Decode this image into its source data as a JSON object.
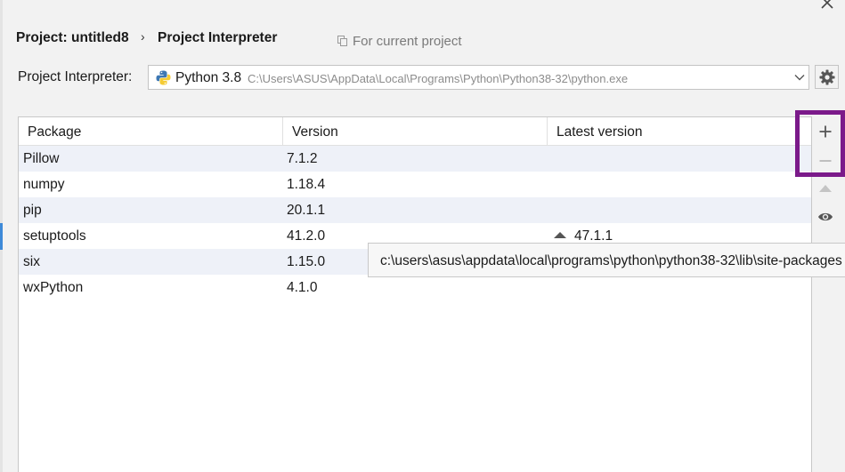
{
  "breadcrumb": {
    "project": "Project: untitled8",
    "separator": "›",
    "page": "Project Interpreter"
  },
  "scope_label": "For current project",
  "interpreter": {
    "label": "Project Interpreter:",
    "name": "Python 3.8",
    "path": "C:\\Users\\ASUS\\AppData\\Local\\Programs\\Python\\Python38-32\\python.exe"
  },
  "table": {
    "columns": [
      "Package",
      "Version",
      "Latest version"
    ],
    "rows": [
      {
        "package": "Pillow",
        "version": "7.1.2",
        "latest": ""
      },
      {
        "package": "numpy",
        "version": "1.18.4",
        "latest": ""
      },
      {
        "package": "pip",
        "version": "20.1.1",
        "latest": ""
      },
      {
        "package": "setuptools",
        "version": "41.2.0",
        "latest": "47.1.1"
      },
      {
        "package": "six",
        "version": "1.15.0",
        "latest": ""
      },
      {
        "package": "wxPython",
        "version": "4.1.0",
        "latest": ""
      }
    ]
  },
  "tooltip": "c:\\users\\asus\\appdata\\local\\programs\\python\\python38-32\\lib\\site-packages",
  "toolbar_icons": [
    "plus-icon",
    "minus-icon",
    "upgrade-icon",
    "eye-icon"
  ],
  "colors": {
    "highlight": "#7b1a8a",
    "row_alt": "#eef1f8",
    "selection_marker": "#3e8ad8"
  }
}
